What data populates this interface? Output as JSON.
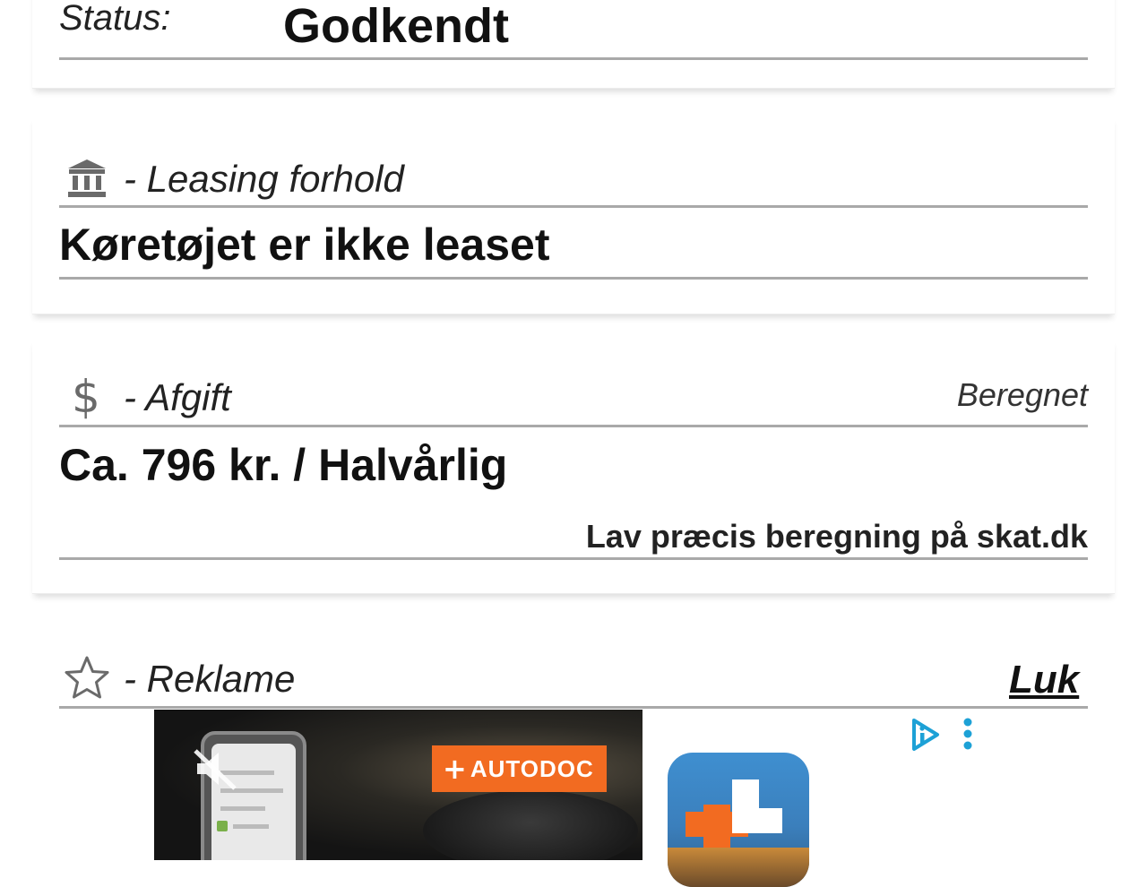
{
  "status": {
    "label": "Status:",
    "value": "Godkendt"
  },
  "leasing": {
    "icon": "bank-icon",
    "title": "- Leasing forhold",
    "value": "Køretøjet er ikke leaset"
  },
  "tax": {
    "icon": "dollar-icon",
    "icon_glyph": "$",
    "title": "- Afgift",
    "note": "Beregnet",
    "value": "Ca. 796 kr. / Halvårlig",
    "link": "Lav præcis beregning på skat.dk"
  },
  "ad": {
    "icon": "star-icon",
    "title": "- Reklame",
    "close_label": "Luk",
    "brand": "AUTODOC",
    "brand_plus": "+",
    "colors": {
      "brand": "#f26b21",
      "adchoices": "#1da1d6"
    }
  }
}
